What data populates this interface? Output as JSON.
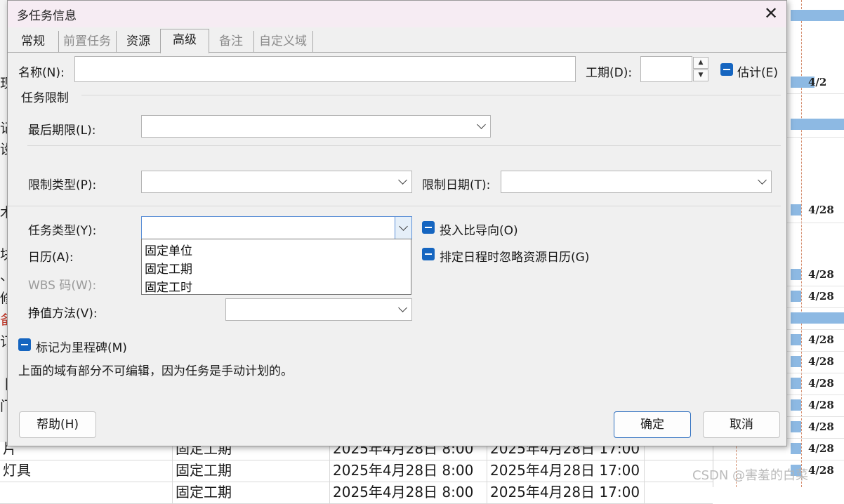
{
  "dialog": {
    "title": "多任务信息",
    "close_glyph": "✕",
    "tabs": [
      {
        "label": "常规",
        "state": "normal"
      },
      {
        "label": "前置任务",
        "state": "disabled"
      },
      {
        "label": "资源",
        "state": "normal"
      },
      {
        "label": "高级",
        "state": "active"
      },
      {
        "label": "备注",
        "state": "disabled"
      },
      {
        "label": "自定义域",
        "state": "disabled"
      }
    ],
    "name_label": "名称(N):",
    "name_value": "",
    "duration_label": "工期(D):",
    "duration_value": "",
    "spin_up": "▲",
    "spin_down": "▼",
    "estimated_label": "估计(E)",
    "constraints_group": "任务限制",
    "deadline_label": "最后期限(L):",
    "deadline_value": "",
    "constraint_type_label": "限制类型(P):",
    "constraint_type_value": "",
    "constraint_date_label": "限制日期(T):",
    "constraint_date_value": "",
    "task_type_label": "任务类型(Y):",
    "task_type_value": "",
    "task_type_options": [
      "固定单位",
      "固定工期",
      "固定工时"
    ],
    "effort_driven_label": "投入比导向(O)",
    "calendar_label": "日历(A):",
    "ignore_resource_calendar_label": "排定日程时忽略资源日历(G)",
    "wbs_label": "WBS 码(W):",
    "earned_value_label": "挣值方法(V):",
    "earned_value_value": "",
    "milestone_label": "标记为里程碑(M)",
    "note": "上面的域有部分不可编辑，因为任务是手动计划的。",
    "help_button": "帮助(H)",
    "ok_button": "确定",
    "cancel_button": "取消"
  },
  "background": {
    "rows": [
      {
        "name": "片",
        "type": "固定工期",
        "start": "2025年4月28日 8:00",
        "finish": "2025年4月28日 17:00"
      },
      {
        "name": "灯具",
        "type": "固定工期",
        "start": "2025年4月28日 8:00",
        "finish": "2025年4月28日 17:00"
      },
      {
        "name": "",
        "type": "固定工期",
        "start": "2025年4月28日 8:00",
        "finish": "2025年4月28日 17:00"
      }
    ],
    "side_letters": [
      "现",
      "记",
      "设",
      "木",
      "块",
      "、",
      "修",
      "备",
      "订",
      "丨",
      "门"
    ],
    "gantt_dates": [
      "4/2",
      "4/28",
      "4/28",
      "4/28",
      "4/28",
      "4/28",
      "4/28",
      "4/28",
      "4/28",
      "4/28",
      "4/28"
    ]
  },
  "watermark": "CSDN @害羞的白菜",
  "colors": {
    "accent": "#1565c0",
    "dialog_bg": "#f0f0f0",
    "title_bg": "#f6ecf3",
    "gantt_bar": "#8db9e3",
    "gantt_line": "#d48b6b"
  }
}
